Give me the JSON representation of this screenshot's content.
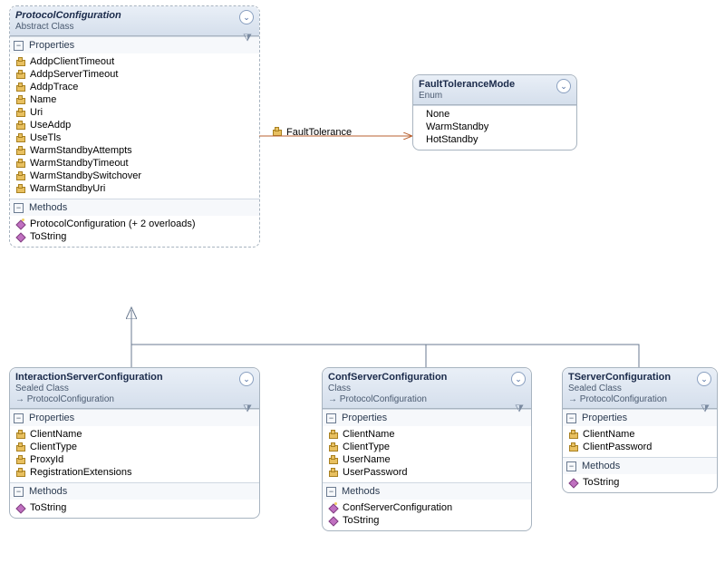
{
  "chart_data": {
    "type": "class-diagram",
    "classes": [
      {
        "id": "ProtocolConfiguration",
        "stereo": "Abstract Class",
        "properties": [
          "AddpClientTimeout",
          "AddpServerTimeout",
          "AddpTrace",
          "Name",
          "Uri",
          "UseAddp",
          "UseTls",
          "WarmStandbyAttempts",
          "WarmStandbyTimeout",
          "WarmStandbySwitchover",
          "WarmStandbyUri"
        ],
        "methods": [
          {
            "name": "ProtocolConfiguration (+ 2 overloads)",
            "ctor": true
          },
          {
            "name": "ToString"
          }
        ]
      },
      {
        "id": "FaultToleranceMode",
        "stereo": "Enum",
        "values": [
          "None",
          "WarmStandby",
          "HotStandby"
        ]
      },
      {
        "id": "InteractionServerConfiguration",
        "stereo": "Sealed Class",
        "inherits": "ProtocolConfiguration",
        "properties": [
          "ClientName",
          "ClientType",
          "ProxyId",
          "RegistrationExtensions"
        ],
        "methods": [
          {
            "name": "ToString"
          }
        ]
      },
      {
        "id": "ConfServerConfiguration",
        "stereo": "Class",
        "inherits": "ProtocolConfiguration",
        "properties": [
          "ClientName",
          "ClientType",
          "UserName",
          "UserPassword"
        ],
        "methods": [
          {
            "name": "ConfServerConfiguration",
            "ctor": true
          },
          {
            "name": "ToString"
          }
        ]
      },
      {
        "id": "TServerConfiguration",
        "stereo": "Sealed Class",
        "inherits": "ProtocolConfiguration",
        "properties": [
          "ClientName",
          "ClientPassword"
        ],
        "methods": [
          {
            "name": "ToString"
          }
        ]
      }
    ],
    "relations": [
      {
        "from": "ProtocolConfiguration",
        "to": "FaultToleranceMode",
        "kind": "association",
        "label": "FaultTolerance"
      },
      {
        "from": "InteractionServerConfiguration",
        "to": "ProtocolConfiguration",
        "kind": "inheritance"
      },
      {
        "from": "ConfServerConfiguration",
        "to": "ProtocolConfiguration",
        "kind": "inheritance"
      },
      {
        "from": "TServerConfiguration",
        "to": "ProtocolConfiguration",
        "kind": "inheritance"
      }
    ]
  },
  "ui": {
    "propHeading": "Properties",
    "methHeading": "Methods"
  }
}
